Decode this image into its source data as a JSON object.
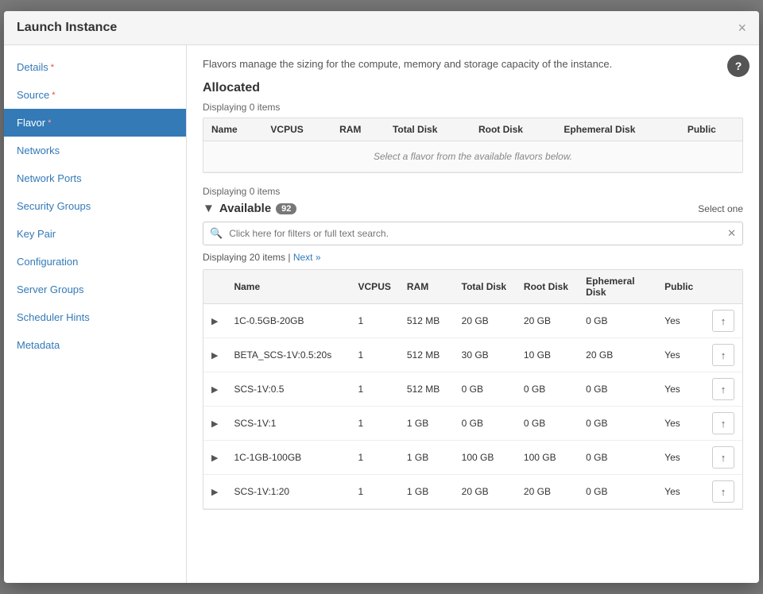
{
  "modal": {
    "title": "Launch Instance",
    "close_label": "×"
  },
  "help": {
    "icon": "?"
  },
  "description": "Flavors manage the sizing for the compute, memory and storage capacity of the instance.",
  "allocated": {
    "section_title": "Allocated",
    "display_info": "Displaying 0 items",
    "columns": [
      "Name",
      "VCPUS",
      "RAM",
      "Total Disk",
      "Root Disk",
      "Ephemeral Disk",
      "Public"
    ],
    "empty_message": "Select a flavor from the available flavors below.",
    "display_info2": "Displaying 0 items"
  },
  "available": {
    "section_title": "Available",
    "badge_count": "92",
    "select_one_label": "Select one",
    "search_placeholder": "Click here for filters or full text search.",
    "display_info": "Displaying 20 items |",
    "next_label": "Next »",
    "columns": [
      "Name",
      "VCPUS",
      "RAM",
      "Total Disk",
      "Root Disk",
      "Ephemeral Disk",
      "Public"
    ],
    "rows": [
      {
        "name": "1C-0.5GB-20GB",
        "vcpus": "1",
        "ram": "512 MB",
        "total_disk": "20 GB",
        "root_disk": "20 GB",
        "ephemeral_disk": "0 GB",
        "public": "Yes"
      },
      {
        "name": "BETA_SCS-1V:0.5:20s",
        "vcpus": "1",
        "ram": "512 MB",
        "total_disk": "30 GB",
        "root_disk": "10 GB",
        "ephemeral_disk": "20 GB",
        "public": "Yes"
      },
      {
        "name": "SCS-1V:0.5",
        "vcpus": "1",
        "ram": "512 MB",
        "total_disk": "0 GB",
        "root_disk": "0 GB",
        "ephemeral_disk": "0 GB",
        "public": "Yes"
      },
      {
        "name": "SCS-1V:1",
        "vcpus": "1",
        "ram": "1 GB",
        "total_disk": "0 GB",
        "root_disk": "0 GB",
        "ephemeral_disk": "0 GB",
        "public": "Yes"
      },
      {
        "name": "1C-1GB-100GB",
        "vcpus": "1",
        "ram": "1 GB",
        "total_disk": "100 GB",
        "root_disk": "100 GB",
        "ephemeral_disk": "0 GB",
        "public": "Yes"
      },
      {
        "name": "SCS-1V:1:20",
        "vcpus": "1",
        "ram": "1 GB",
        "total_disk": "20 GB",
        "root_disk": "20 GB",
        "ephemeral_disk": "0 GB",
        "public": "Yes"
      }
    ]
  },
  "sidebar": {
    "items": [
      {
        "label": "Details",
        "required": true,
        "active": false,
        "id": "details"
      },
      {
        "label": "Source",
        "required": true,
        "active": false,
        "id": "source"
      },
      {
        "label": "Flavor",
        "required": true,
        "active": true,
        "id": "flavor"
      },
      {
        "label": "Networks",
        "required": false,
        "active": false,
        "id": "networks"
      },
      {
        "label": "Network Ports",
        "required": false,
        "active": false,
        "id": "network-ports"
      },
      {
        "label": "Security Groups",
        "required": false,
        "active": false,
        "id": "security-groups"
      },
      {
        "label": "Key Pair",
        "required": false,
        "active": false,
        "id": "key-pair"
      },
      {
        "label": "Configuration",
        "required": false,
        "active": false,
        "id": "configuration"
      },
      {
        "label": "Server Groups",
        "required": false,
        "active": false,
        "id": "server-groups"
      },
      {
        "label": "Scheduler Hints",
        "required": false,
        "active": false,
        "id": "scheduler-hints"
      },
      {
        "label": "Metadata",
        "required": false,
        "active": false,
        "id": "metadata"
      }
    ]
  }
}
